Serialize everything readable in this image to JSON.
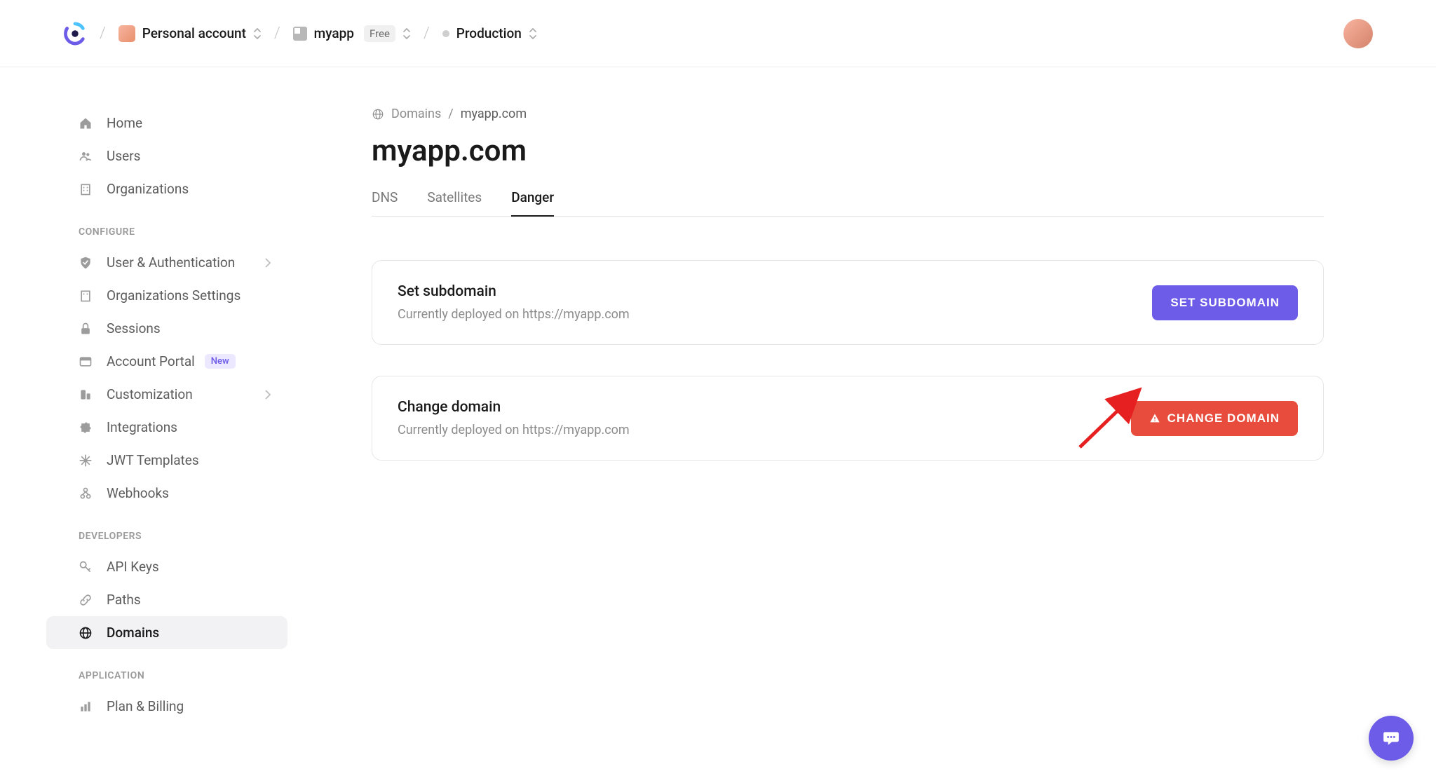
{
  "header": {
    "account": "Personal account",
    "app": "myapp",
    "plan": "Free",
    "environment": "Production"
  },
  "sidebar": {
    "items_top": [
      {
        "label": "Home",
        "icon": "home"
      },
      {
        "label": "Users",
        "icon": "users"
      },
      {
        "label": "Organizations",
        "icon": "building"
      }
    ],
    "section_configure": "CONFIGURE",
    "items_configure": [
      {
        "label": "User & Authentication",
        "icon": "shield",
        "chevron": true
      },
      {
        "label": "Organizations Settings",
        "icon": "building"
      },
      {
        "label": "Sessions",
        "icon": "lock"
      },
      {
        "label": "Account Portal",
        "icon": "portal",
        "badge": "New"
      },
      {
        "label": "Customization",
        "icon": "paint",
        "chevron": true
      },
      {
        "label": "Integrations",
        "icon": "puzzle"
      },
      {
        "label": "JWT Templates",
        "icon": "jwt"
      },
      {
        "label": "Webhooks",
        "icon": "webhook"
      }
    ],
    "section_developers": "DEVELOPERS",
    "items_developers": [
      {
        "label": "API Keys",
        "icon": "key"
      },
      {
        "label": "Paths",
        "icon": "link"
      },
      {
        "label": "Domains",
        "icon": "globe",
        "active": true
      }
    ],
    "section_application": "APPLICATION",
    "items_application": [
      {
        "label": "Plan & Billing",
        "icon": "chart"
      }
    ]
  },
  "main": {
    "breadcrumb_root": "Domains",
    "breadcrumb_current": "myapp.com",
    "title": "myapp.com",
    "tabs": [
      {
        "label": "DNS",
        "active": false
      },
      {
        "label": "Satellites",
        "active": false
      },
      {
        "label": "Danger",
        "active": true
      }
    ],
    "cards": [
      {
        "title": "Set subdomain",
        "subtitle": "Currently deployed on https://myapp.com",
        "button": "Set Subdomain",
        "variant": "primary"
      },
      {
        "title": "Change domain",
        "subtitle": "Currently deployed on https://myapp.com",
        "button": "Change Domain",
        "variant": "danger"
      }
    ]
  }
}
